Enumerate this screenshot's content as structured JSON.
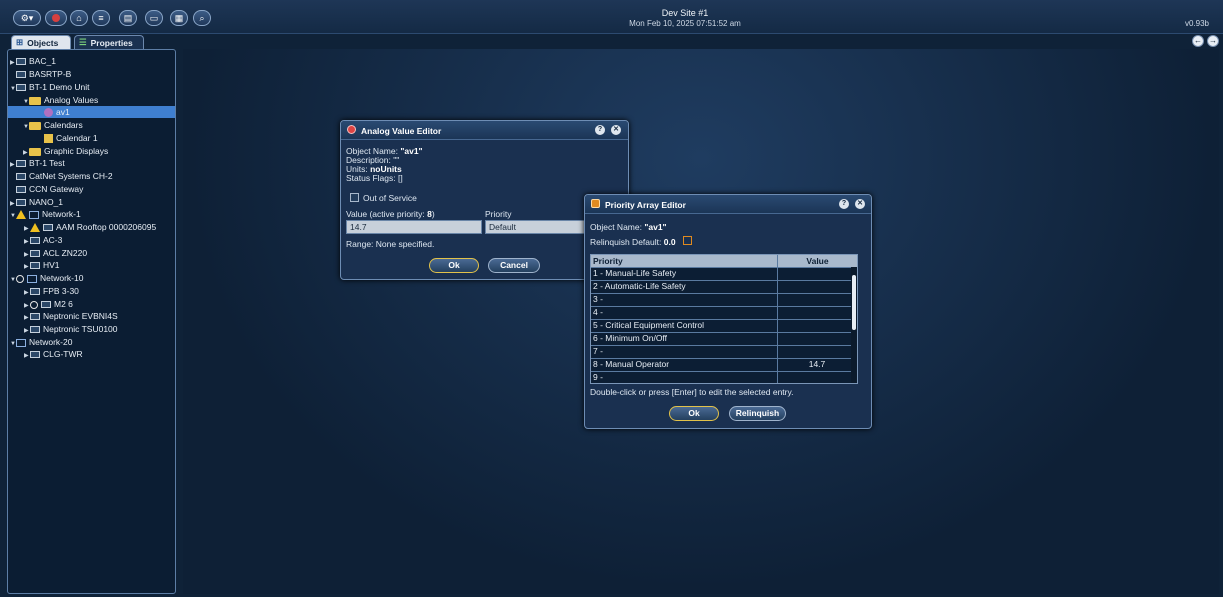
{
  "header": {
    "site_title": "Dev Site #1",
    "datetime": "Mon Feb 10, 2025 07:51:52 am",
    "version": "v0.93b",
    "toolbar_icons": [
      "gear-menu-icon",
      "back-icon",
      "home-icon",
      "alarms-icon",
      "calendar-view-icon",
      "monitor-icon",
      "schedule-icon",
      "search-icon"
    ]
  },
  "tabs": {
    "objects": "Objects",
    "properties": "Properties"
  },
  "tree": [
    {
      "label": "BAC_1"
    },
    {
      "label": "BASRTP-B"
    },
    {
      "label": "BT-1 Demo Unit"
    },
    {
      "label": "Analog Values"
    },
    {
      "label": "av1"
    },
    {
      "label": "Calendars"
    },
    {
      "label": "Calendar 1"
    },
    {
      "label": "Graphic Displays"
    },
    {
      "label": "BT-1 Test"
    },
    {
      "label": "CatNet Systems CH-2"
    },
    {
      "label": "CCN Gateway"
    },
    {
      "label": "NANO_1"
    },
    {
      "label": "Network-1"
    },
    {
      "label": "AAM Rooftop 0000206095"
    },
    {
      "label": "AC-3"
    },
    {
      "label": "ACL ZN220"
    },
    {
      "label": "HV1"
    },
    {
      "label": "Network-10"
    },
    {
      "label": "FPB 3-30"
    },
    {
      "label": "M2 6"
    },
    {
      "label": "Neptronic EVBNI4S"
    },
    {
      "label": "Neptronic TSU0100"
    },
    {
      "label": "Network-20"
    },
    {
      "label": "CLG-TWR"
    }
  ],
  "ave": {
    "title": "Analog Value Editor",
    "object_name_label": "Object Name:",
    "object_name": "\"av1\"",
    "description_label": "Description:",
    "description": "\"\"",
    "units_label": "Units:",
    "units": "noUnits",
    "status_label": "Status Flags:",
    "status": "[]",
    "out_of_service": "Out of Service",
    "value_label": "Value (active priority:",
    "active_priority": "8",
    "value_label_end": ")",
    "priority_label": "Priority",
    "value": "14.7",
    "priority": "Default",
    "range": "Range: None specified.",
    "ok": "Ok",
    "cancel": "Cancel"
  },
  "pae": {
    "title": "Priority Array Editor",
    "object_name_label": "Object Name:",
    "object_name": "\"av1\"",
    "relinquish_label": "Relinquish Default:",
    "relinquish_default": "0.0",
    "col_priority": "Priority",
    "col_value": "Value",
    "rows": [
      {
        "p": "1 - Manual-Life Safety",
        "v": ""
      },
      {
        "p": "2 - Automatic-Life Safety",
        "v": ""
      },
      {
        "p": "3 -",
        "v": ""
      },
      {
        "p": "4 -",
        "v": ""
      },
      {
        "p": "5 - Critical Equipment Control",
        "v": ""
      },
      {
        "p": "6 - Minimum On/Off",
        "v": ""
      },
      {
        "p": "7 -",
        "v": ""
      },
      {
        "p": "8 - Manual Operator",
        "v": "14.7"
      },
      {
        "p": "9 -",
        "v": ""
      }
    ],
    "hint": "Double-click or press [Enter] to edit the selected entry.",
    "ok": "Ok",
    "relinquish": "Relinquish"
  },
  "colors": {
    "accent": "#3f7fd0",
    "background": "#0f2238",
    "highlight": "#e2c24a"
  }
}
